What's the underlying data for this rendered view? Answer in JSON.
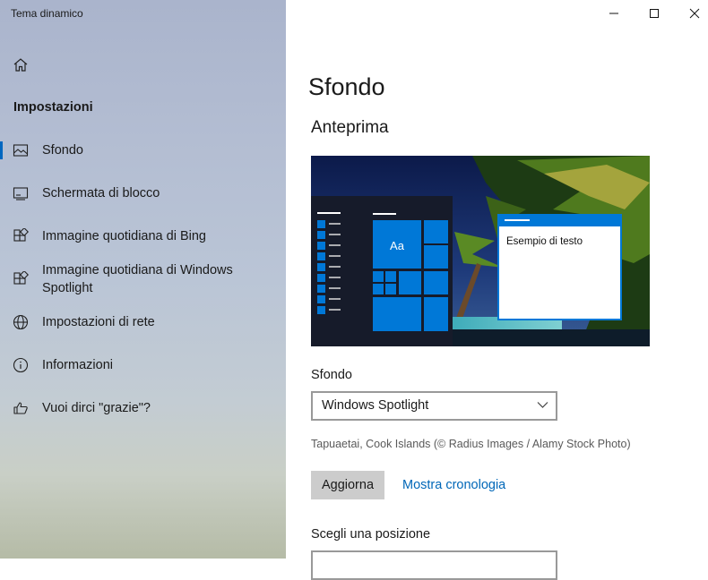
{
  "window": {
    "title": "Tema dinamico",
    "controls": [
      "minimize-icon",
      "maximize-icon",
      "close-icon"
    ]
  },
  "sidebar": {
    "home_icon": "home-icon",
    "section_title": "Impostazioni",
    "items": [
      {
        "label": "Sfondo",
        "icon": "picture-icon",
        "active": true
      },
      {
        "label": "Schermata di blocco",
        "icon": "lockscreen-icon",
        "active": false
      },
      {
        "label": "Immagine quotidiana di Bing",
        "icon": "apps-icon",
        "active": false
      },
      {
        "label": "Immagine quotidiana di Windows Spotlight",
        "icon": "apps-icon",
        "active": false
      },
      {
        "label": "Impostazioni di rete",
        "icon": "globe-icon",
        "active": false
      },
      {
        "label": "Informazioni",
        "icon": "info-icon",
        "active": false
      },
      {
        "label": "Vuoi dirci \"grazie\"?",
        "icon": "thumbs-up-icon",
        "active": false
      }
    ]
  },
  "main": {
    "title": "Sfondo",
    "preview_title": "Anteprima",
    "preview": {
      "tile_label": "Aa",
      "sample_text": "Esempio di testo"
    },
    "background_label": "Sfondo",
    "background_value": "Windows Spotlight",
    "image_caption": "Tapuaetai, Cook Islands (© Radius Images / Alamy Stock Photo)",
    "refresh_button": "Aggiorna",
    "history_link": "Mostra cronologia",
    "position_label": "Scegli una posizione"
  },
  "colors": {
    "accent": "#0078d7",
    "link": "#0067b8",
    "button_bg": "#cccccc"
  }
}
